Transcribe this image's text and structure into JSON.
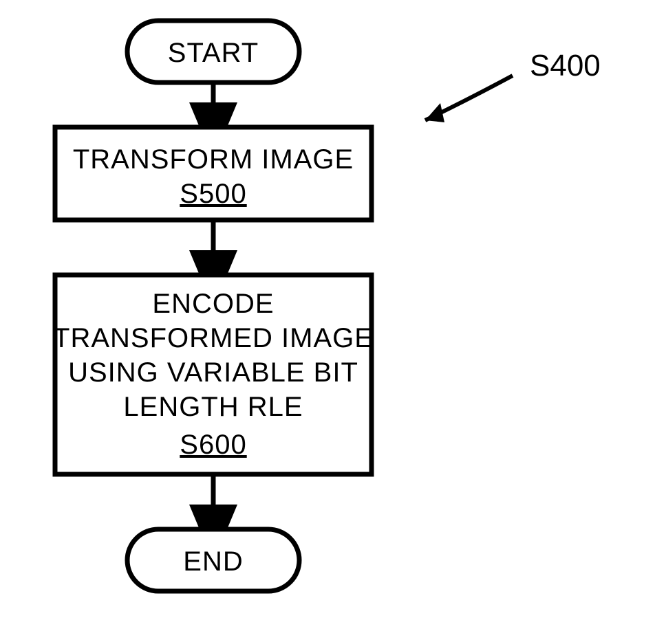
{
  "figure_label": "S400",
  "terminators": {
    "start": "START",
    "end": "END"
  },
  "steps": {
    "transform": {
      "title": "TRANSFORM IMAGE",
      "ref": "S500"
    },
    "encode": {
      "line1": "ENCODE",
      "line2": "TRANSFORMED IMAGE",
      "line3": "USING VARIABLE BIT",
      "line4": "LENGTH RLE",
      "ref": "S600"
    }
  }
}
